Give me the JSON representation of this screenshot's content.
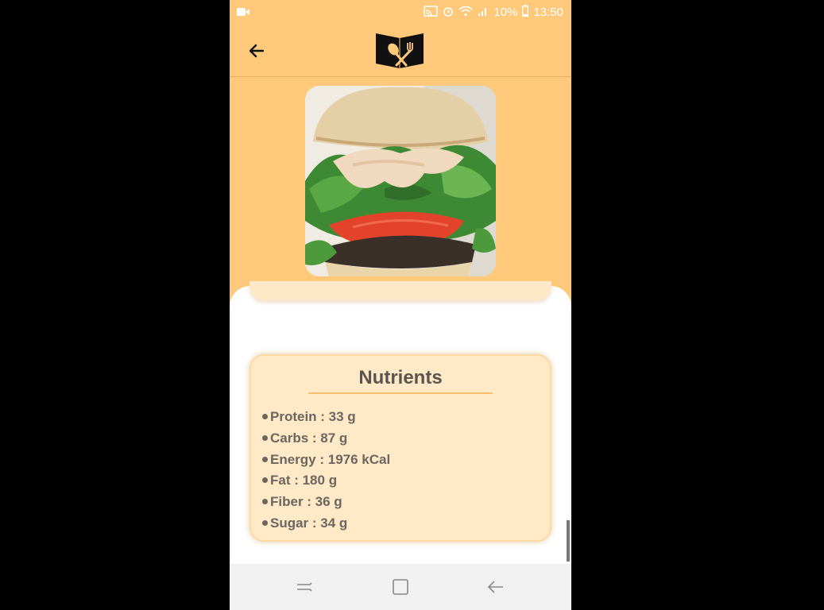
{
  "status_bar": {
    "battery": "10%",
    "time": "13:50"
  },
  "colors": {
    "header_bg": "#fec97a",
    "card_bg": "#ffe9c6",
    "accent_rule": "#f5be6a",
    "text": "#5a5550"
  },
  "icons": {
    "back": "arrow-left-icon",
    "logo": "recipe-book-fork-spoon-logo",
    "nav_recent": "recent-apps-icon",
    "nav_home": "home-square-icon",
    "nav_back": "back-triangle-icon"
  },
  "nutrients": {
    "title": "Nutrients",
    "items": [
      {
        "text": "Protein : 33 g"
      },
      {
        "text": "Carbs : 87 g"
      },
      {
        "text": "Energy : 1976 kCal"
      },
      {
        "text": "Fat : 180 g"
      },
      {
        "text": "Fiber : 36 g"
      },
      {
        "text": "Sugar : 34 g"
      }
    ]
  }
}
